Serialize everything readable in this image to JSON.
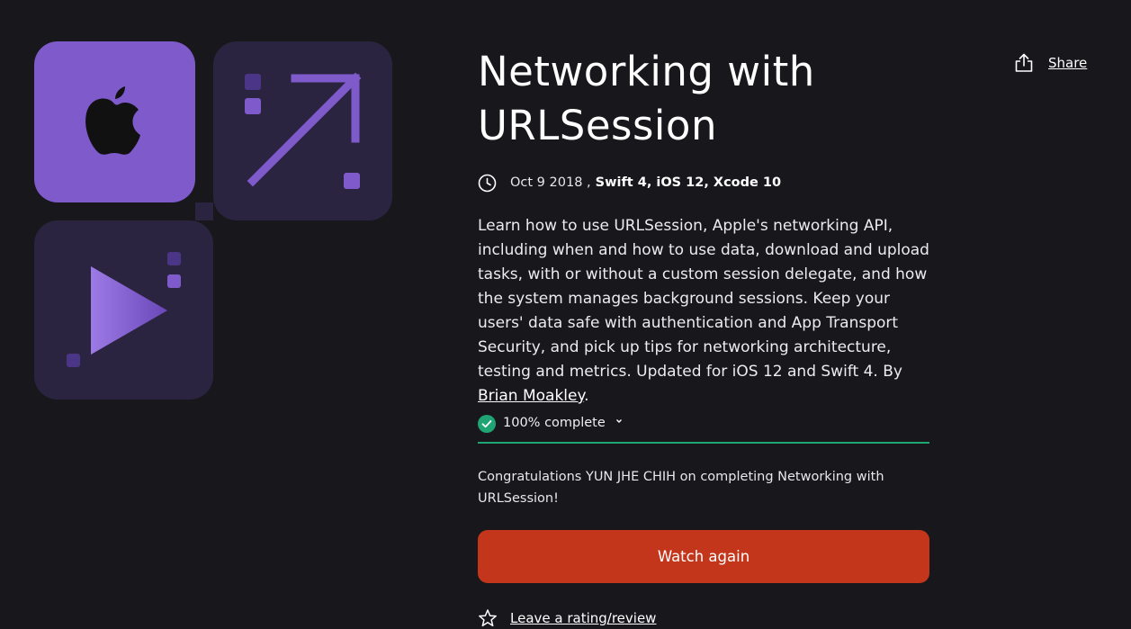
{
  "course": {
    "title_line1": "Networking with",
    "title_line2": "URLSession",
    "date": "Oct 9 2018 ,",
    "tech": "Swift 4, iOS 12, Xcode 10",
    "description": "Learn how to use URLSession, Apple's networking API, including when and how to use data, download and upload tasks, with or without a custom session delegate, and how the system manages background sessions. Keep your users' data safe with authentication and App Transport Security, and pick up tips for networking architecture, testing and metrics. Updated for iOS 12 and Swift 4. By ",
    "author": "Brian Moakley",
    "description_end": "."
  },
  "progress": {
    "label": "100% complete",
    "percent": 100
  },
  "congrats": "Congratulations YUN JHE CHIH on completing Networking with URLSession!",
  "actions": {
    "watch_again": "Watch again",
    "rating": "Leave a rating/review",
    "share": "Share"
  },
  "icons": {
    "clock": "clock-icon",
    "check": "check-circle-icon",
    "chevron": "chevron-down-icon",
    "star": "star-outline-icon",
    "share": "share-icon"
  },
  "colors": {
    "background": "#17171c",
    "accent_purple": "#7f5acb",
    "tile_dark": "#2b2440",
    "progress_green": "#1fa573",
    "button_red": "#c4361b"
  }
}
